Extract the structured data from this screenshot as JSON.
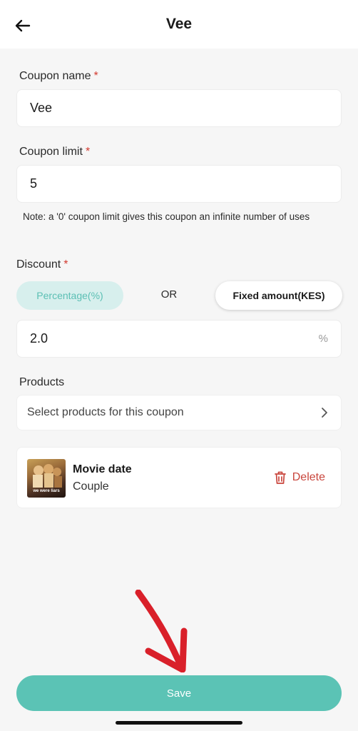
{
  "header": {
    "title": "Vee"
  },
  "form": {
    "coupon_name": {
      "label": "Coupon name",
      "required_mark": "*",
      "value": "Vee"
    },
    "coupon_limit": {
      "label": "Coupon limit",
      "required_mark": "*",
      "value": "5",
      "note": "Note: a '0' coupon limit gives this coupon an infinite number of uses"
    },
    "discount": {
      "label": "Discount",
      "required_mark": "*",
      "option_percentage": "Percentage(%)",
      "or_text": "OR",
      "option_fixed": "Fixed amount(KES)",
      "value": "2.0",
      "suffix": "%"
    },
    "products": {
      "label": "Products",
      "select_placeholder": "Select products for this coupon",
      "items": [
        {
          "name": "Movie date",
          "subtitle": "Couple",
          "thumbnail_text": "we were liars",
          "delete_label": "Delete"
        }
      ]
    }
  },
  "actions": {
    "save_label": "Save"
  },
  "colors": {
    "accent": "#5bc3b5",
    "accent_light": "#d7efed",
    "required": "#d23a2f",
    "delete": "#c9463d",
    "annotation_arrow": "#d9202a"
  }
}
